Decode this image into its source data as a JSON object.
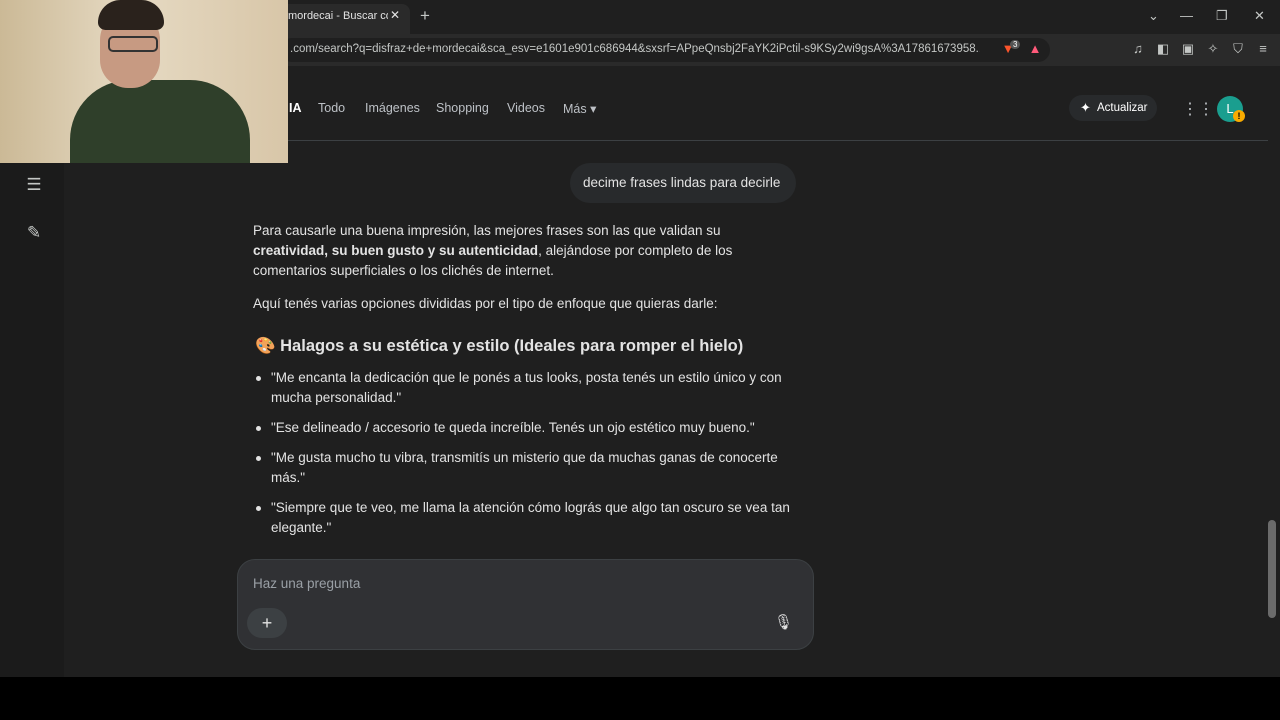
{
  "browser": {
    "tab_title": "mordecai - Buscar con Google",
    "close_glyph": "✕",
    "new_tab_glyph": "+",
    "url": ".com/search?q=disfraz+de+mordecai&sca_esv=e1601e901c686944&sxsrf=APpeQnsbj2FaYK2iPctil-s9KSy2wi9gsA%3A17861673958...",
    "window_controls": [
      "⌄",
      "—",
      "❐",
      "✕"
    ],
    "brave_badge": "3"
  },
  "search": {
    "tabs": [
      {
        "label": "IA",
        "active": true
      },
      {
        "label": "Todo"
      },
      {
        "label": "Imágenes"
      },
      {
        "label": "Shopping"
      },
      {
        "label": "Videos"
      },
      {
        "label": "Más ▾"
      }
    ],
    "upgrade_label": "Actualizar",
    "avatar_letter": "L",
    "avatar_badge": "!"
  },
  "chat": {
    "user_message": "decime frases lindas para decirle",
    "p1_a": "Para causarle una buena impresión, las mejores frases son las que validan su",
    "p1_bold": "creatividad, su buen gusto y su autenticidad",
    "p1_b": ", alejándose por completo de los comentarios superficiales o los clichés de internet.",
    "p2": "Aquí tenés varias opciones divididas por el tipo de enfoque que quieras darle:",
    "section_emoji": "🎨",
    "section_title": "Halagos a su estética y estilo (Ideales para romper el hielo)",
    "bullets": [
      "\"Me encanta la dedicación que le ponés a tus looks, posta tenés un estilo único y con mucha personalidad.\"",
      "\"Ese delineado / accesorio te queda increíble. Tenés un ojo estético muy bueno.\"",
      "\"Me gusta mucho tu vibra, transmitís un misterio que da muchas ganas de conocerte más.\"",
      "\"Siempre que te veo, me llama la atención cómo lográs que algo tan oscuro se vea tan elegante.\""
    ]
  },
  "composer": {
    "placeholder": "Haz una pregunta",
    "value": ""
  },
  "colors": {
    "accent": "#1a9e8f",
    "background": "#1f1f1f"
  }
}
